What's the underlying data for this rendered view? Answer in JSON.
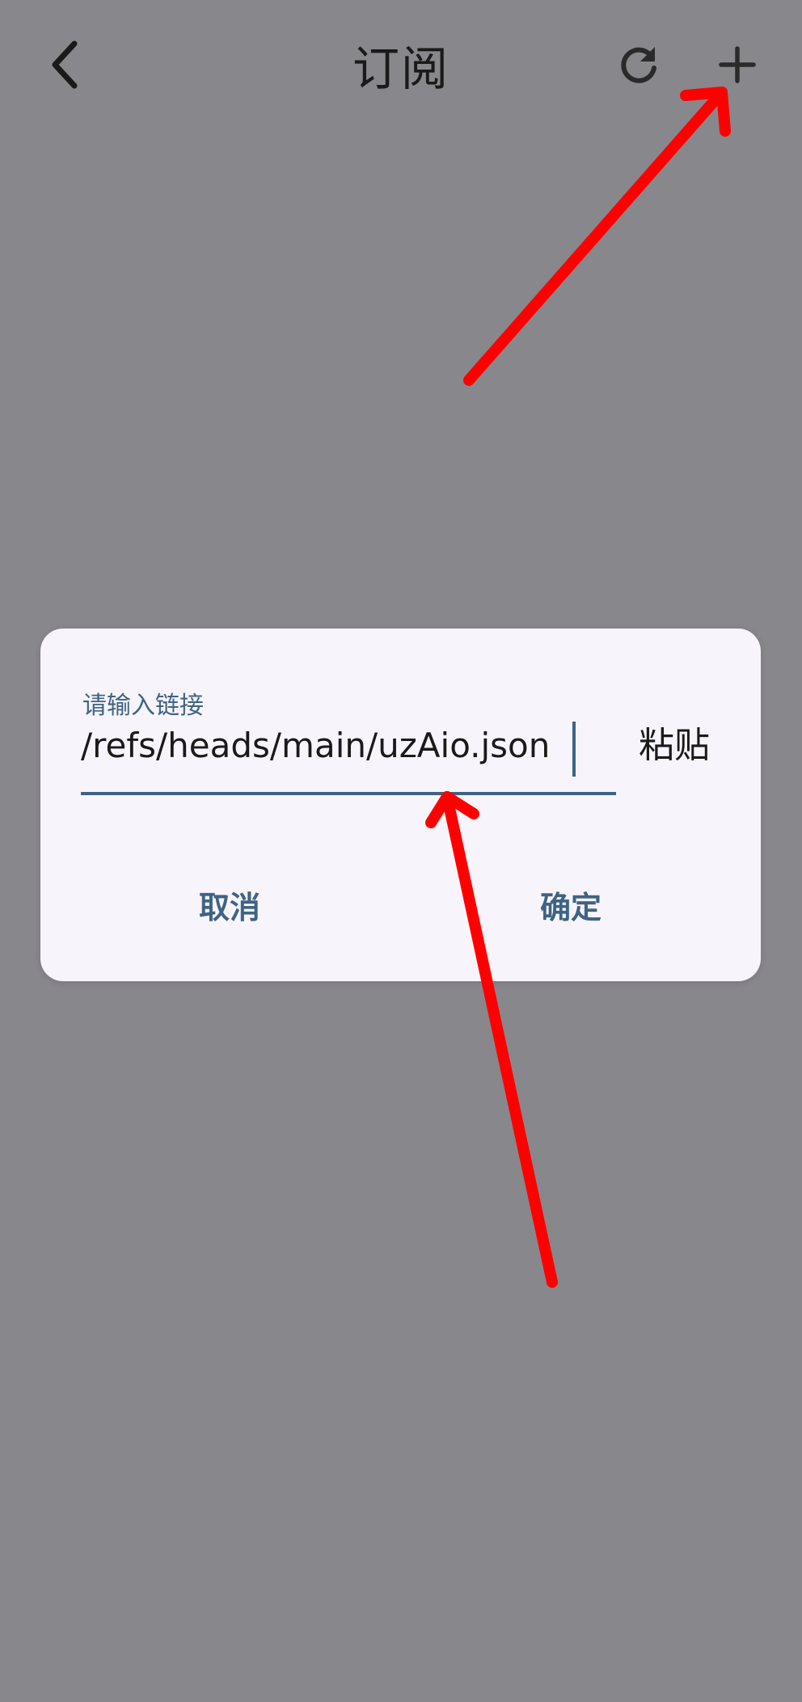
{
  "appbar": {
    "title": "订阅",
    "back_icon": "chevron-left-icon",
    "refresh_icon": "refresh-icon",
    "add_icon": "plus-icon"
  },
  "dialog": {
    "input_label": "请输入链接",
    "input_value": "/refs/heads/main/uzAio.json",
    "paste_label": "粘贴",
    "cancel_label": "取消",
    "confirm_label": "确定"
  },
  "colors": {
    "scrim_background": "#88878c",
    "dialog_background": "#f7f5fb",
    "accent": "#3f6384",
    "annotation_arrow": "#ff0000"
  }
}
